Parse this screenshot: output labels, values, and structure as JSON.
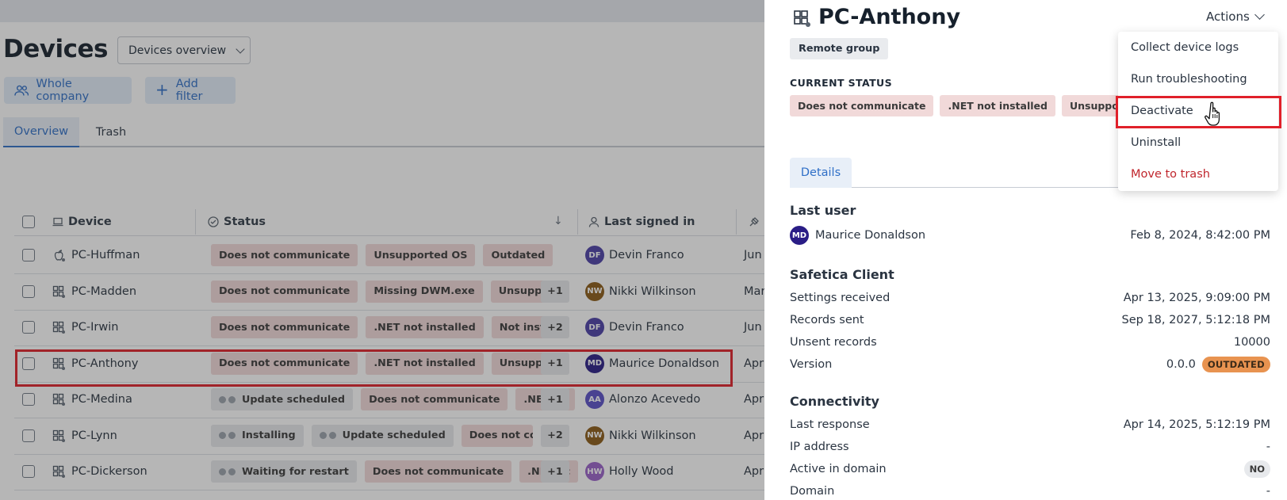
{
  "page": {
    "title": "Devices",
    "view_select": "Devices overview",
    "filters": {
      "company": "Whole company",
      "add_filter": "Add filter"
    },
    "tabs": [
      {
        "label": "Overview"
      },
      {
        "label": "Trash"
      }
    ]
  },
  "grid": {
    "columns": {
      "device": "Device",
      "status": "Status",
      "last_signed_in": "Last signed in"
    },
    "rows": [
      {
        "device": "PC-Huffman",
        "os": "mac",
        "badges": [
          {
            "label": "Does not communicate",
            "tone": "red",
            "dots": false
          },
          {
            "label": "Unsupported OS",
            "tone": "red",
            "dots": false
          },
          {
            "label": "Outdated",
            "tone": "red",
            "dots": false
          }
        ],
        "more": "",
        "user": "Devin Franco",
        "initials": "DF",
        "avatar_color": "#4b3fa6",
        "last": "Jun"
      },
      {
        "device": "PC-Madden",
        "os": "win",
        "badges": [
          {
            "label": "Does not communicate",
            "tone": "red",
            "dots": false
          },
          {
            "label": "Missing DWM.exe",
            "tone": "red",
            "dots": false
          },
          {
            "label": "Unsupported",
            "tone": "red",
            "dots": false
          }
        ],
        "more": "+1",
        "user": "Nikki Wilkinson",
        "initials": "NW",
        "avatar_color": "#8b5a16",
        "last": "Mar"
      },
      {
        "device": "PC-Irwin",
        "os": "win",
        "badges": [
          {
            "label": "Does not communicate",
            "tone": "red",
            "dots": false
          },
          {
            "label": ".NET not installed",
            "tone": "red",
            "dots": false
          },
          {
            "label": "Not installed",
            "tone": "red",
            "dots": false
          }
        ],
        "more": "+2",
        "user": "Devin Franco",
        "initials": "DF",
        "avatar_color": "#4b3fa6",
        "last": "Jun"
      },
      {
        "device": "PC-Anthony",
        "os": "win",
        "badges": [
          {
            "label": "Does not communicate",
            "tone": "red",
            "dots": false
          },
          {
            "label": ".NET not installed",
            "tone": "red",
            "dots": false
          },
          {
            "label": "Unsupported",
            "tone": "red",
            "dots": false
          }
        ],
        "more": "+1",
        "user": "Maurice Donaldson",
        "initials": "MD",
        "avatar_color": "#2a1d86",
        "last": "Apr"
      },
      {
        "device": "PC-Medina",
        "os": "win",
        "badges": [
          {
            "label": "Update scheduled",
            "tone": "grey",
            "dots": true
          },
          {
            "label": "Does not communicate",
            "tone": "red",
            "dots": false
          },
          {
            "label": ".NET nc",
            "tone": "red",
            "dots": false
          }
        ],
        "more": "+1",
        "user": "Alonzo Acevedo",
        "initials": "AA",
        "avatar_color": "#5a4fc7",
        "last": "Apr"
      },
      {
        "device": "PC-Lynn",
        "os": "win",
        "badges": [
          {
            "label": "Installing",
            "tone": "grey",
            "dots": true
          },
          {
            "label": "Update scheduled",
            "tone": "grey",
            "dots": true
          },
          {
            "label": "Does not comm",
            "tone": "red",
            "dots": false
          }
        ],
        "more": "+2",
        "user": "Nikki Wilkinson",
        "initials": "NW",
        "avatar_color": "#8b5a16",
        "last": "Apr"
      },
      {
        "device": "PC-Dickerson",
        "os": "win",
        "badges": [
          {
            "label": "Waiting for restart",
            "tone": "grey",
            "dots": true
          },
          {
            "label": "Does not communicate",
            "tone": "red",
            "dots": false
          },
          {
            "label": ".NET nc",
            "tone": "red",
            "dots": false
          }
        ],
        "more": "+1",
        "user": "Holly Wood",
        "initials": "HW",
        "avatar_color": "#9a62c9",
        "last": "Apr"
      }
    ]
  },
  "panel": {
    "title": "PC-Anthony",
    "group": "Remote group",
    "actions_label": "Actions",
    "current_status_label": "CURRENT STATUS",
    "status_badges": [
      "Does not communicate",
      ".NET not installed",
      "Unsupported O"
    ],
    "tab": "Details",
    "last_user": {
      "heading": "Last user",
      "name": "Maurice Donaldson",
      "initials": "MD",
      "date": "Feb 8, 2024, 8:42:00 PM"
    },
    "client": {
      "heading": "Safetica Client",
      "rows": [
        {
          "label": "Settings received",
          "value": "Apr 13, 2025, 9:09:00 PM"
        },
        {
          "label": "Records sent",
          "value": "Sep 18, 2027, 5:12:18 PM"
        },
        {
          "label": "Unsent records",
          "value": "10000"
        }
      ],
      "version_label": "Version",
      "version_value": "0.0.0",
      "version_tag": "OUTDATED"
    },
    "connectivity": {
      "heading": "Connectivity",
      "last_response_label": "Last response",
      "last_response_value": "Apr 14, 2025, 5:12:19 PM",
      "ip_label": "IP address",
      "ip_value": "-",
      "active_label": "Active in domain",
      "active_value": "NO",
      "domain_label": "Domain",
      "domain_value": "-"
    },
    "menu": [
      {
        "label": "Collect device logs",
        "danger": false
      },
      {
        "label": "Run troubleshooting",
        "danger": false
      },
      {
        "label": "Deactivate",
        "danger": false
      },
      {
        "label": "Uninstall",
        "danger": false
      },
      {
        "label": "Move to trash",
        "danger": true
      }
    ]
  },
  "colors": {
    "accent": "#2f6fc7",
    "highlight": "#e0202a",
    "danger_text": "#c0262d",
    "status_red_bg": "#f1d9d9",
    "outdated": "#e89350"
  }
}
